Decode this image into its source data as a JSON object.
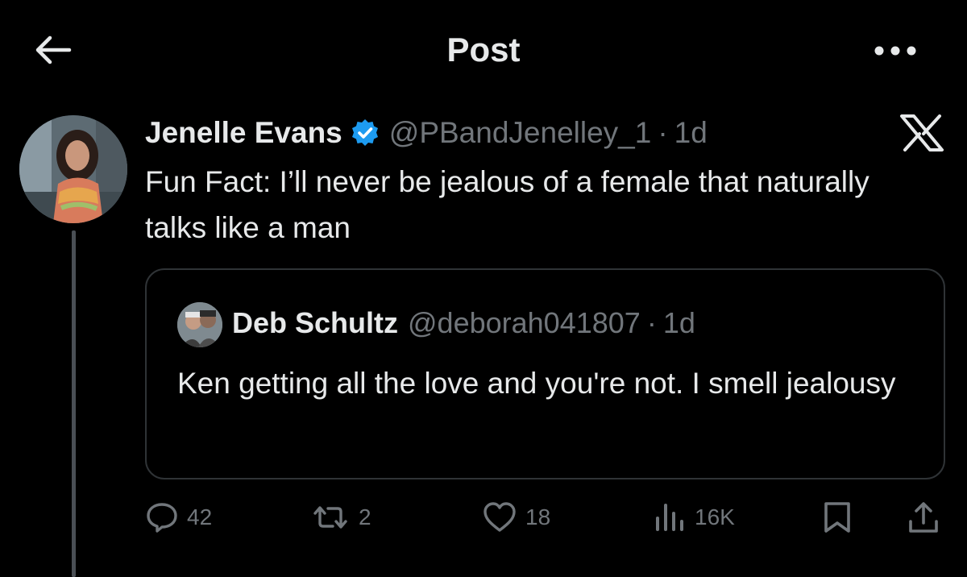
{
  "header": {
    "title": "Post"
  },
  "post": {
    "author_name": "Jenelle Evans",
    "handle": "@PBandJenelley_1",
    "separator": "·",
    "time": "1d",
    "text": "Fun Fact: I’ll never be jealous of a female that naturally talks like a man"
  },
  "quote": {
    "author_name": "Deb Schultz",
    "handle": "@deborah041807",
    "separator": "·",
    "time": "1d",
    "text": "Ken getting all the love and you're not. I smell jealousy"
  },
  "actions": {
    "replies": "42",
    "reposts": "2",
    "likes": "18",
    "views": "16K"
  },
  "icons": {
    "back": "arrow-left-icon",
    "more": "more-dots-icon",
    "verified": "verified-badge-icon",
    "platform": "x-logo-icon",
    "reply": "reply-icon",
    "repost": "repost-icon",
    "like": "heart-icon",
    "views": "views-icon",
    "bookmark": "bookmark-icon",
    "share": "share-icon"
  },
  "colors": {
    "background": "#000000",
    "text": "#e7e9ea",
    "muted": "#71767b",
    "verified": "#1d9bf0",
    "border": "#2f3336"
  }
}
